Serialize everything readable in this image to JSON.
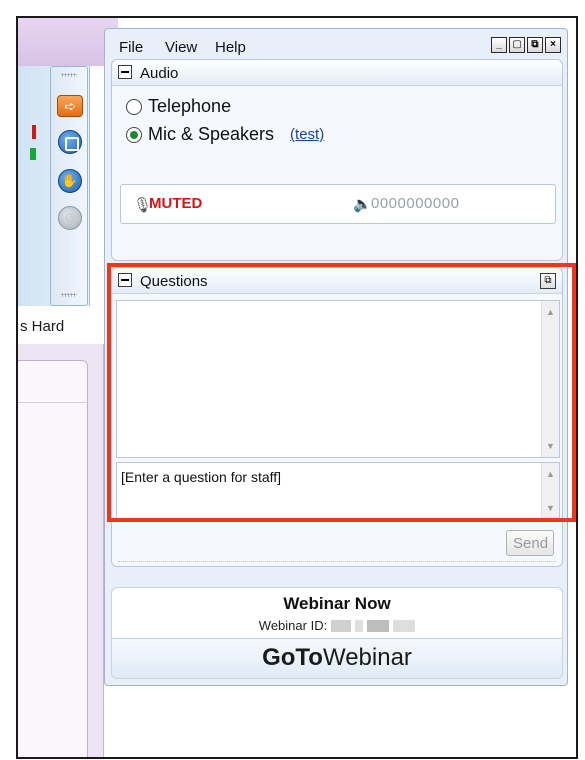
{
  "menu": {
    "file": "File",
    "view": "View",
    "help": "Help"
  },
  "window_buttons": {
    "minimize": "_",
    "restore": "▢",
    "popout": "⧉",
    "close": "×"
  },
  "audio": {
    "title": "Audio",
    "option_telephone": "Telephone",
    "option_mic": "Mic & Speakers",
    "test_link": "(test)",
    "selected": "Mic & Speakers",
    "status": "MUTED",
    "level": "0000000000"
  },
  "questions": {
    "title": "Questions",
    "input_placeholder": "[Enter a question for staff]",
    "send_label": "Send"
  },
  "webinar": {
    "name": "Webinar Now",
    "id_label": "Webinar ID:"
  },
  "brand": {
    "bold": "GoTo",
    "light": "Webinar"
  },
  "background_app": {
    "title_fragment": "s Hard"
  },
  "colors": {
    "muted": "#d01818",
    "highlight": "#ea3a1c",
    "link": "#1a3fb0"
  }
}
